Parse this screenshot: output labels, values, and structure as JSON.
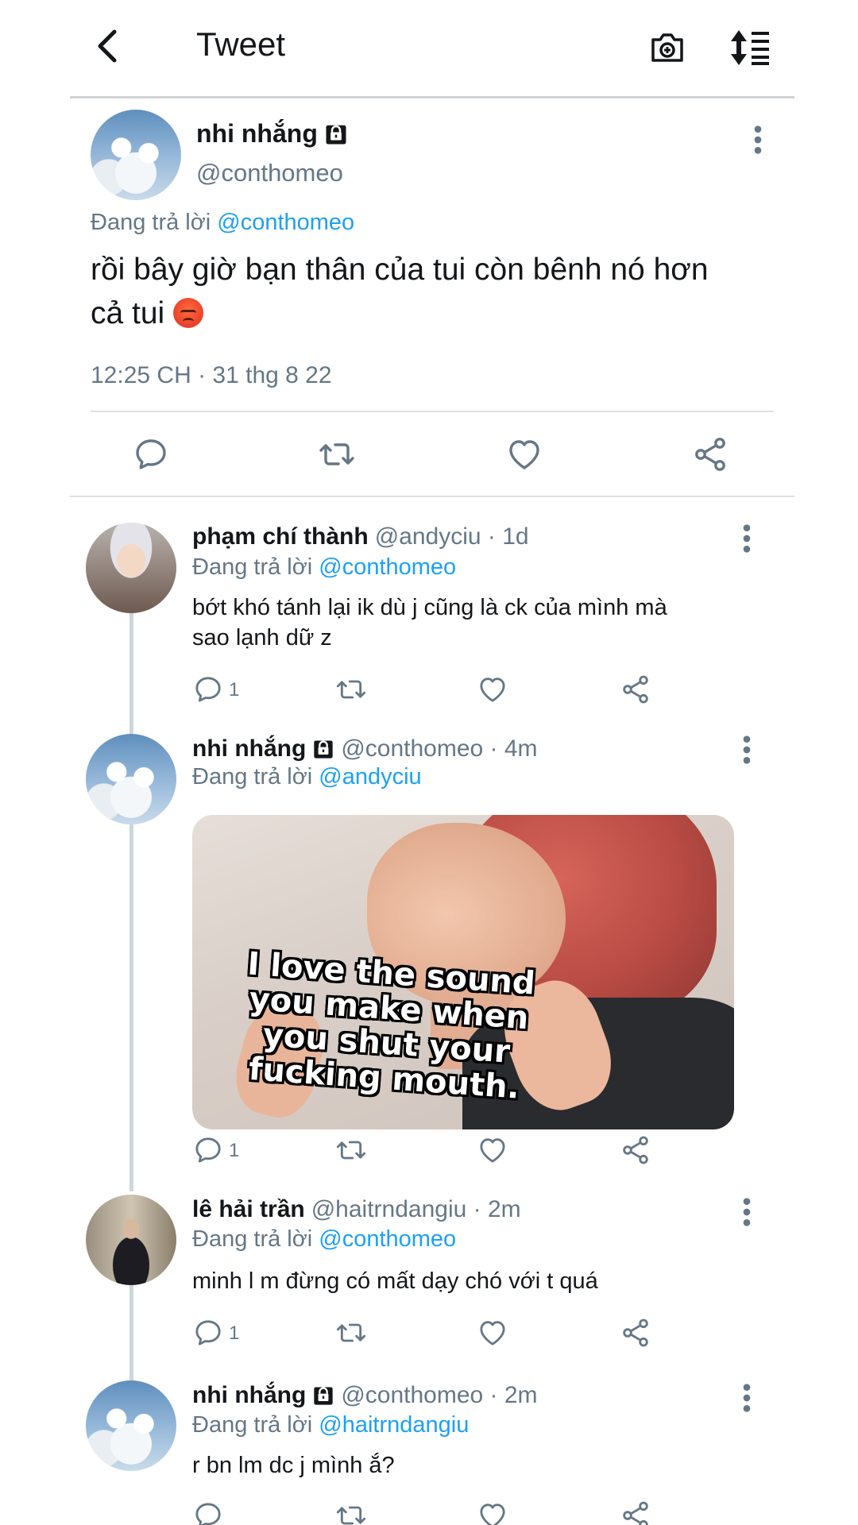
{
  "header": {
    "title": "Tweet",
    "back_icon": "chevron-left-icon",
    "camera_icon": "camera-plus-icon",
    "sort_icon": "sort-list-icon"
  },
  "main_tweet": {
    "name": "nhi nhắng",
    "handle": "@conthomeo",
    "reply_prefix": "Đang trả lời",
    "reply_to": "@conthomeo",
    "text_line1": "rồi bây giờ bạn thân của tui còn bênh nó hơn",
    "text_line2": "cả tui",
    "emoji": "angry-face-emoji",
    "timestamp": "12:25 CH · 31 thg 8 22"
  },
  "replies": [
    {
      "name": "phạm chí thành",
      "meta": "@andyciu · 1d",
      "reply_prefix": "Đang trả lời",
      "reply_to": "@conthomeo",
      "text_line1": "bớt khó tánh lại ik dù j cũng là ck của mình mà",
      "text_line2": "sao lạnh dữ z",
      "reply_count": "1"
    },
    {
      "name": "nhi nhắng",
      "meta": "@conthomeo · 4m",
      "reply_prefix": "Đang trả lời",
      "reply_to": "@andyciu",
      "meme_caption_1": "I love the sound",
      "meme_caption_2": "you make when",
      "meme_caption_3": "you shut your",
      "meme_caption_4": "fucking mouth.",
      "reply_count": "1"
    },
    {
      "name": "lê hải trần",
      "meta": "@haitrndangiu · 2m",
      "reply_prefix": "Đang trả lời",
      "reply_to": "@conthomeo",
      "text_line1": "minh l m đừng có mất dạy chó với t quá",
      "reply_count": "1"
    },
    {
      "name": "nhi nhắng",
      "meta": "@conthomeo · 2m",
      "reply_prefix": "Đang trả lời",
      "reply_to": "@haitrndangiu",
      "text_line1": "r bn lm dc j mình ắ?"
    }
  ],
  "colors": {
    "link": "#1da1f2",
    "muted": "#657786",
    "text": "#14171a",
    "divider": "#dde1e4"
  }
}
